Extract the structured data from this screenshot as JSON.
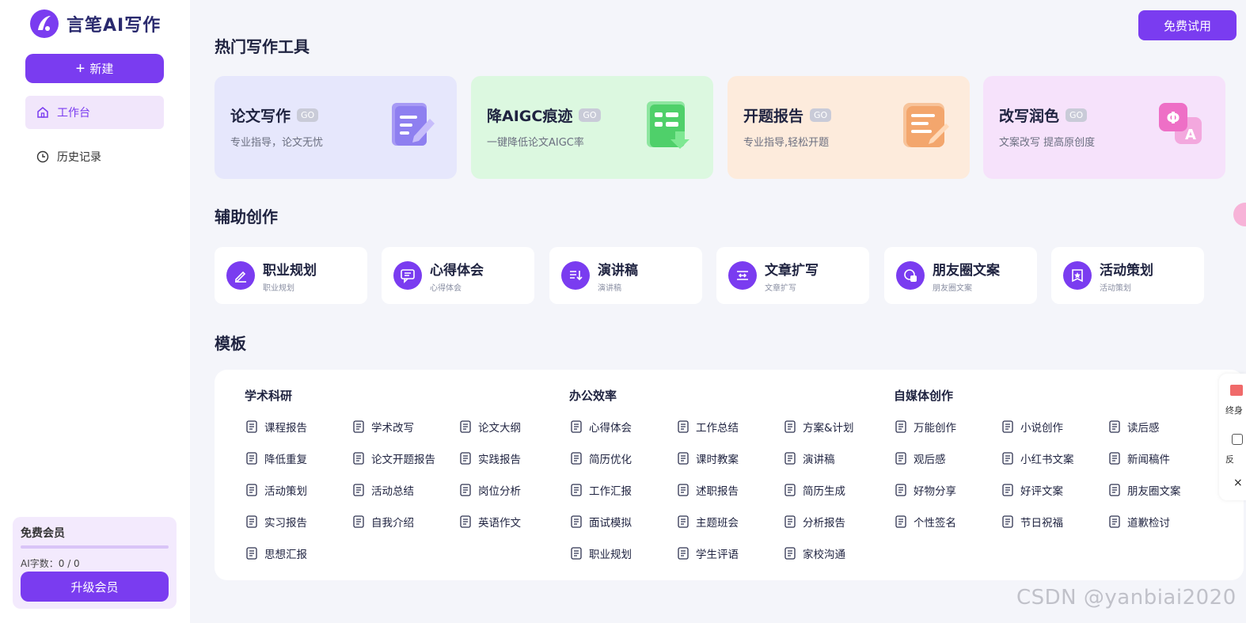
{
  "app": {
    "logo_text": "言笔AI写作",
    "accent": "#7a3cf0"
  },
  "sidebar": {
    "new_label": "新建",
    "items": [
      {
        "label": "工作台",
        "icon": "home-icon",
        "active": true
      },
      {
        "label": "历史记录",
        "icon": "clock-icon",
        "active": false
      }
    ],
    "member": {
      "title": "免费会员",
      "words_label": "AI字数：0 / 0",
      "upgrade_label": "升级会员"
    }
  },
  "header": {
    "trial_label": "免费试用"
  },
  "sections": {
    "hot_tools": "热门写作工具",
    "assist": "辅助创作",
    "templates": "模板"
  },
  "hot_tools": [
    {
      "name": "论文写作",
      "go": "GO",
      "desc": "专业指导，论文无忧",
      "bg": "#e6e7fc",
      "icon": "paper-pen-icon"
    },
    {
      "name": "降AIGC痕迹",
      "go": "GO",
      "desc": "一键降低论文AIGC率",
      "bg": "#dcf8e0",
      "icon": "document-down-icon"
    },
    {
      "name": "开题报告",
      "go": "GO",
      "desc": "专业指导,轻松开题",
      "bg": "#fdebdc",
      "icon": "report-pen-icon"
    },
    {
      "name": "改写润色",
      "go": "GO",
      "desc": "文案改写 提高原创度",
      "bg": "#f6e2fb",
      "icon": "translate-icon"
    }
  ],
  "assist": [
    {
      "title": "职业规划",
      "sub": "职业规划",
      "icon": "pen-edit-icon"
    },
    {
      "title": "心得体会",
      "sub": "心得体会",
      "icon": "chat-note-icon"
    },
    {
      "title": "演讲稿",
      "sub": "演讲稿",
      "icon": "speech-list-icon"
    },
    {
      "title": "文章扩写",
      "sub": "文章扩写",
      "icon": "expand-icon"
    },
    {
      "title": "朋友圈文案",
      "sub": "朋友圈文案",
      "icon": "social-icon"
    },
    {
      "title": "活动策划",
      "sub": "活动策划",
      "icon": "star-badge-icon"
    }
  ],
  "templates": {
    "categories": [
      {
        "title": "学术科研",
        "items": [
          "课程报告",
          "学术改写",
          "论文大纲",
          "降低重复",
          "论文开题报告",
          "实践报告",
          "活动策划",
          "活动总结",
          "岗位分析",
          "实习报告",
          "自我介绍",
          "英语作文",
          "思想汇报"
        ]
      },
      {
        "title": "办公效率",
        "items": [
          "心得体会",
          "工作总结",
          "方案&计划",
          "简历优化",
          "课时教案",
          "演讲稿",
          "工作汇报",
          "述职报告",
          "简历生成",
          "面试模拟",
          "主题班会",
          "分析报告",
          "职业规划",
          "学生评语",
          "家校沟通"
        ]
      },
      {
        "title": "自媒体创作",
        "items": [
          "万能创作",
          "小说创作",
          "读后感",
          "观后感",
          "小红书文案",
          "新闻稿件",
          "好物分享",
          "好评文案",
          "朋友圈文案",
          "个性签名",
          "节日祝福",
          "道歉检讨"
        ]
      }
    ]
  },
  "float_panel": {
    "label1": "终身",
    "label2": "反"
  },
  "watermark": "CSDN @yanbiai2020"
}
